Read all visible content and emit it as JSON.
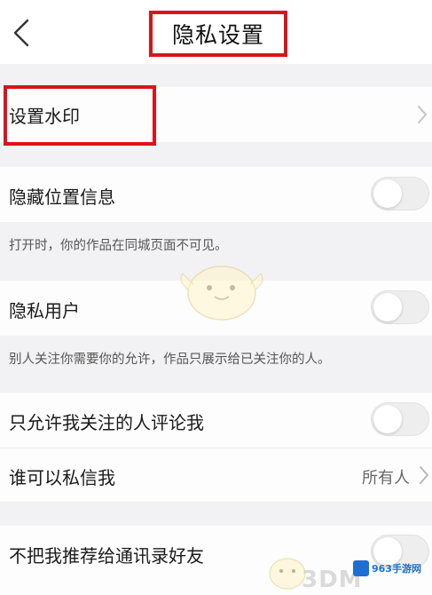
{
  "header": {
    "title": "隐私设置",
    "back_icon": "chevron-left-icon"
  },
  "rows": {
    "watermark": {
      "label": "设置水印",
      "icon": "chevron-right-icon"
    },
    "hide_location": {
      "label": "隐藏位置信息",
      "toggle_on": false,
      "hint": "打开时，你的作品在同城页面不可见。"
    },
    "private_user": {
      "label": "隐私用户",
      "toggle_on": false,
      "hint": "别人关注你需要你的允许，作品只展示给已关注你的人。"
    },
    "comment_followed_only": {
      "label": "只允许我关注的人评论我",
      "toggle_on": false
    },
    "who_can_message": {
      "label": "谁可以私信我",
      "value": "所有人",
      "icon": "chevron-right-icon"
    },
    "no_recommend_contacts": {
      "label": "不把我推荐给通讯录好友",
      "toggle_on": false
    }
  },
  "watermark_overlay": {
    "site_logo_text": "963手游网",
    "brand_text": "3DM"
  },
  "colors": {
    "highlight": "#d9141b",
    "background": "#f2f2f4",
    "row_background": "#fdfdfd",
    "toggle_off": "#eeeeee"
  }
}
